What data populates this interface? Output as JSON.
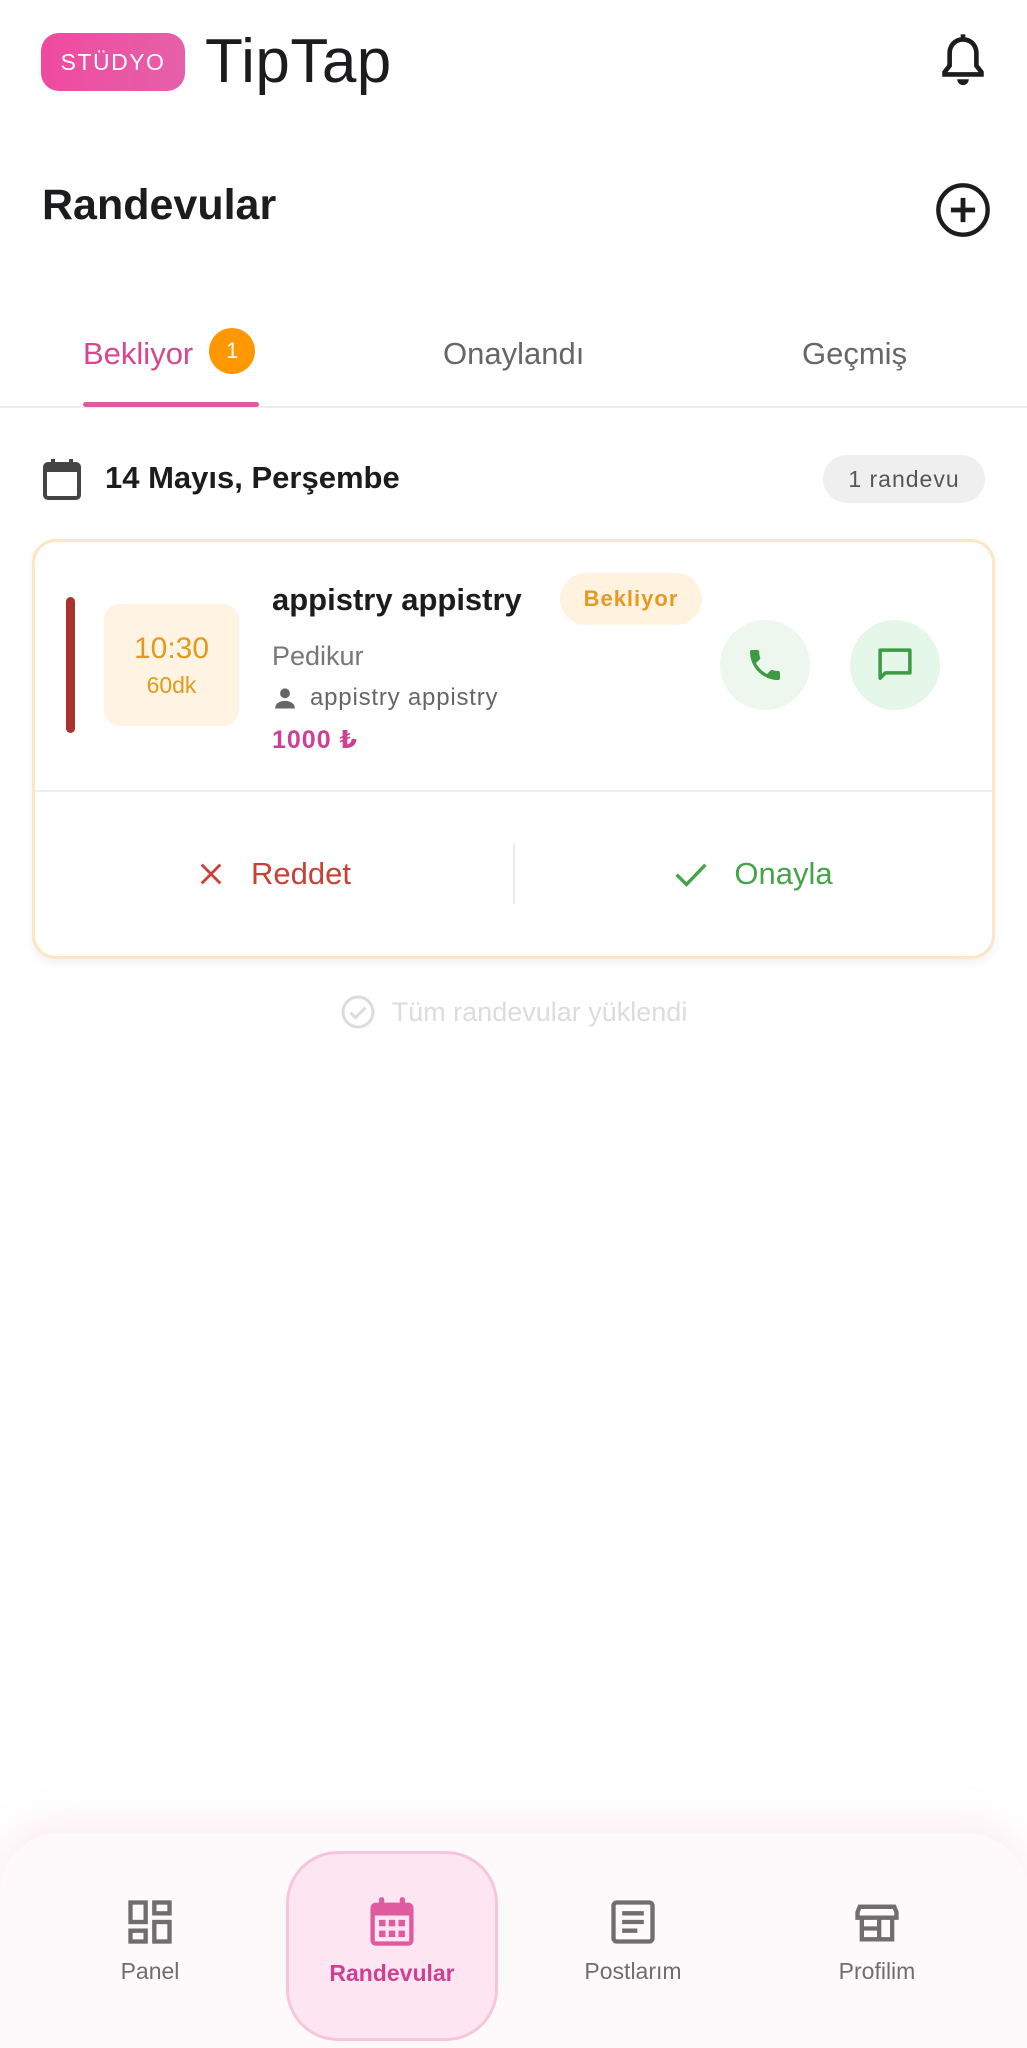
{
  "header": {
    "badge": "STÜDYO",
    "app_title": "TipTap"
  },
  "page": {
    "title": "Randevular"
  },
  "tabs": [
    {
      "label": "Bekliyor",
      "badge": "1",
      "active": true
    },
    {
      "label": "Onaylandı"
    },
    {
      "label": "Geçmiş"
    }
  ],
  "date_group": {
    "date": "14 Mayıs, Perşembe",
    "count": "1 randevu"
  },
  "appointment": {
    "time": "10:30",
    "duration": "60dk",
    "customer": "appistry appistry",
    "status": "Bekliyor",
    "service": "Pedikur",
    "staff": "appistry appistry",
    "price": "1000 ₺",
    "reject_label": "Reddet",
    "approve_label": "Onayla"
  },
  "footer_note": "Tüm randevular yüklendi",
  "bottom_nav": [
    {
      "label": "Panel",
      "icon": "dashboard-icon"
    },
    {
      "label": "Randevular",
      "icon": "calendar-icon",
      "active": true
    },
    {
      "label": "Postlarım",
      "icon": "article-icon"
    },
    {
      "label": "Profilim",
      "icon": "storefront-icon"
    }
  ],
  "colors": {
    "brand_pink": "#d6478f",
    "pending_orange": "#ff9800",
    "reject_red": "#c94037",
    "approve_green": "#45a349"
  }
}
